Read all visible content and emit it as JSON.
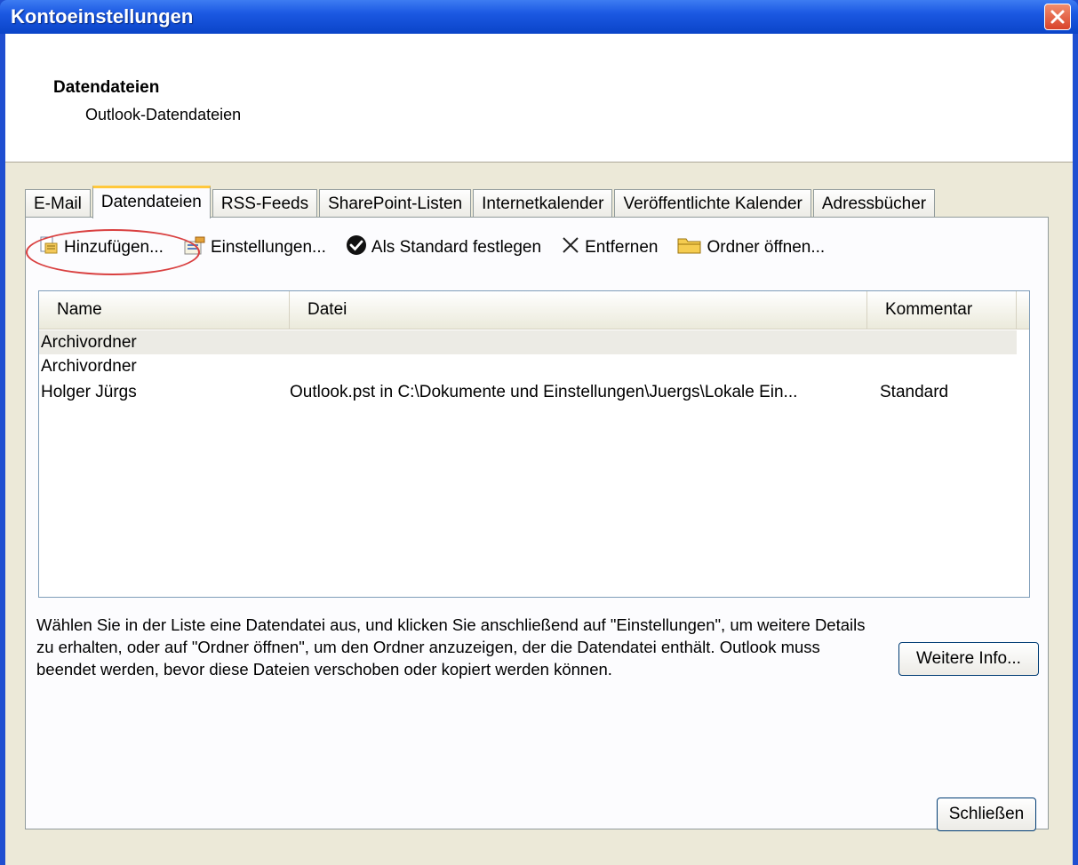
{
  "window": {
    "title": "Kontoeinstellungen"
  },
  "header": {
    "title": "Datendateien",
    "subtitle": "Outlook-Datendateien"
  },
  "tabs": [
    {
      "label": "E-Mail",
      "active": false
    },
    {
      "label": "Datendateien",
      "active": true
    },
    {
      "label": "RSS-Feeds",
      "active": false
    },
    {
      "label": "SharePoint-Listen",
      "active": false
    },
    {
      "label": "Internetkalender",
      "active": false
    },
    {
      "label": "Veröffentlichte Kalender",
      "active": false
    },
    {
      "label": "Adressbücher",
      "active": false
    }
  ],
  "toolbar": {
    "add_label": "Hinzufügen...",
    "settings_label": "Einstellungen...",
    "set_default_label": "Als Standard festlegen",
    "remove_label": "Entfernen",
    "open_folder_label": "Ordner öffnen..."
  },
  "list": {
    "columns": [
      "Name",
      "Datei",
      "Kommentar"
    ],
    "rows": [
      {
        "name": "Archivordner",
        "file": "",
        "comment": "",
        "selected": true,
        "file_redacted": true
      },
      {
        "name": "Archivordner",
        "file": "",
        "comment": "",
        "selected": false,
        "file_redacted": true
      },
      {
        "name": "Holger Jürgs",
        "file": "Outlook.pst in C:\\Dokumente und Einstellungen\\Juergs\\Lokale Ein...",
        "comment": "Standard",
        "selected": false,
        "file_redacted": false
      }
    ]
  },
  "info": {
    "text": "Wählen Sie in der Liste eine Datendatei aus, und klicken Sie anschließend auf \"Einstellungen\", um weitere Details zu erhalten, oder auf \"Ordner öffnen\", um den Ordner anzuzeigen, der die Datendatei enthält. Outlook muss beendet werden, bevor diese Dateien verschoben oder kopiert werden können.",
    "more_info_label": "Weitere Info..."
  },
  "footer": {
    "close_label": "Schließen"
  },
  "colors": {
    "titlebar": "#0a44c8",
    "dialog_bg": "#ece9d8",
    "active_tab_accent": "#ffc83c",
    "highlight_oval": "#d94040"
  }
}
